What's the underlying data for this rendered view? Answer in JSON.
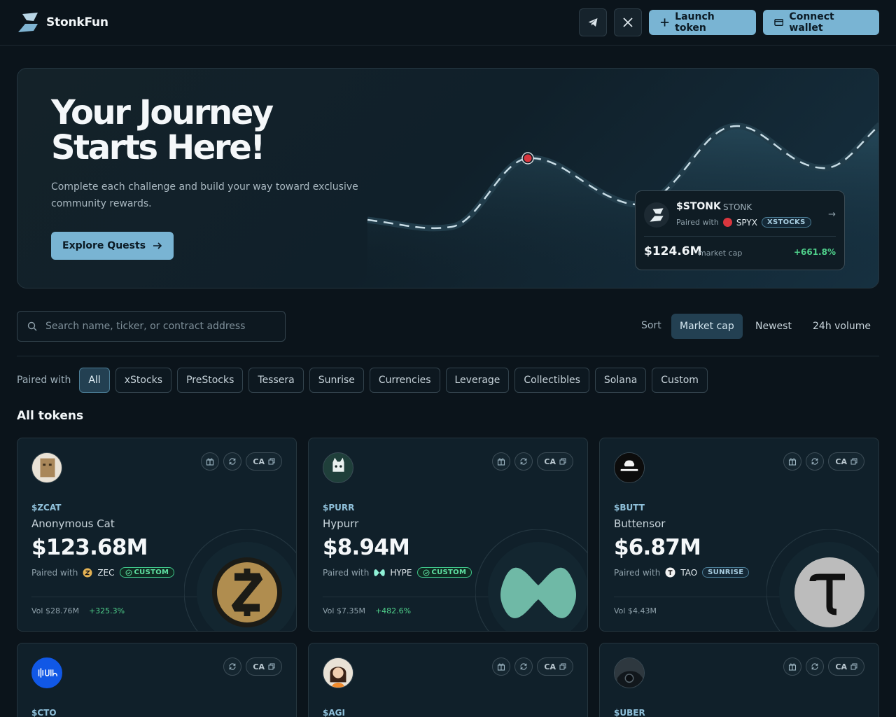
{
  "header": {
    "brand": "StonkFun",
    "launch_label": "Launch token",
    "connect_label": "Connect wallet"
  },
  "hero": {
    "title": "Your Journey Starts Here!",
    "subtitle": "Complete each challenge and build your way toward exclusive community rewards.",
    "cta": "Explore Quests",
    "featured": {
      "ticker": "$STONK",
      "name": "STONK",
      "paired_label": "Paired with",
      "pair_symbol": "SPYX",
      "tag": "XSTOCKS",
      "market_cap": "$124.6M",
      "market_cap_label": "market cap",
      "change": "+661.8%"
    }
  },
  "search": {
    "placeholder": "Search name, ticker, or contract address"
  },
  "sort": {
    "label": "Sort",
    "options": [
      "Market cap",
      "Newest",
      "24h volume"
    ],
    "selected": "Market cap"
  },
  "filters": {
    "label": "Paired with",
    "options": [
      "All",
      "xStocks",
      "PreStocks",
      "Tessera",
      "Sunrise",
      "Currencies",
      "Leverage",
      "Collectibles",
      "Solana",
      "Custom"
    ],
    "selected": "All"
  },
  "section_title": "All tokens",
  "tokens": [
    {
      "ticker": "$ZCAT",
      "name": "Anonymous Cat",
      "market_cap": "$123.68M",
      "paired_label": "Paired with",
      "pair_symbol": "ZEC",
      "tag": "CUSTOM",
      "volume": "Vol $28.76M",
      "change": "+325.3%",
      "ca": "CA",
      "has_gift": true
    },
    {
      "ticker": "$PURR",
      "name": "Hypurr",
      "market_cap": "$8.94M",
      "paired_label": "Paired with",
      "pair_symbol": "HYPE",
      "tag": "CUSTOM",
      "volume": "Vol $7.35M",
      "change": "+482.6%",
      "ca": "CA",
      "has_gift": true
    },
    {
      "ticker": "$BUTT",
      "name": "Buttensor",
      "market_cap": "$6.87M",
      "paired_label": "Paired with",
      "pair_symbol": "TAO",
      "tag": "SUNRISE",
      "volume": "Vol $4.43M",
      "change": "",
      "ca": "CA",
      "has_gift": true
    },
    {
      "ticker": "$CTO",
      "ca": "CA",
      "has_gift": false
    },
    {
      "ticker": "$AGI",
      "ca": "CA",
      "has_gift": true
    },
    {
      "ticker": "$UBER",
      "ca": "CA",
      "has_gift": true
    }
  ],
  "colors": {
    "background": "#0b141b",
    "accent": "#79b4d3",
    "positive": "#4fd18b",
    "custom_tag": "#3fc68a"
  },
  "icons": [
    "brand-logo",
    "telegram-icon",
    "x-icon",
    "plus-icon",
    "wallet-icon",
    "arrow-right-icon",
    "search-icon",
    "gift-icon",
    "refresh-icon",
    "copy-icon",
    "check-circle-icon"
  ]
}
